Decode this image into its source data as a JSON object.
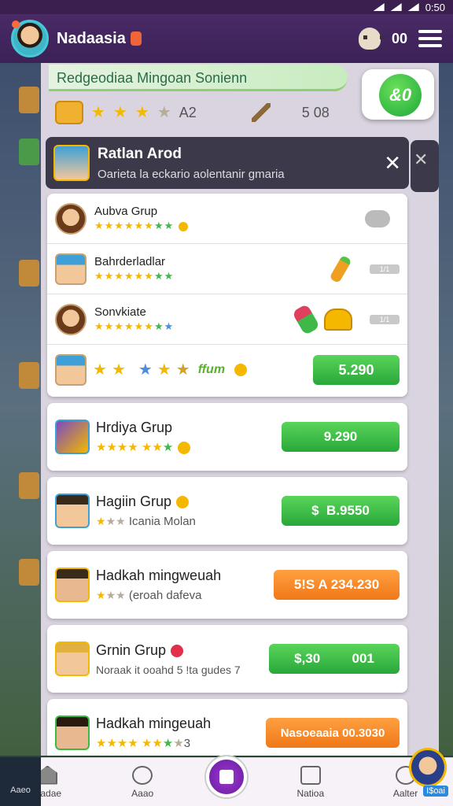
{
  "status_bar": {
    "time": "0:50"
  },
  "header": {
    "title": "Nadaasia",
    "coins": "00"
  },
  "panel": {
    "top_strip": "Redgeodiaa Mingoan Sonienn",
    "green_button": "&0",
    "stats": {
      "rating": "A2",
      "count": "5 08"
    }
  },
  "notification": {
    "title": "Ratlan Arod",
    "subtitle": "Oarieta la eckario aolentanir gmaria",
    "bg_close": "✕"
  },
  "group_rows": [
    {
      "name": "Aubva Grup",
      "badge": ""
    },
    {
      "name": "Bahrderladlar",
      "badge": "1/1"
    },
    {
      "name": "Sonvkiate",
      "badge": "1/1"
    },
    {
      "name": "",
      "button": "5.290",
      "tag": "ffum"
    }
  ],
  "cards": [
    {
      "name": "Hrdiya Grup",
      "sub": "",
      "button": "9.290",
      "color": "green"
    },
    {
      "name": "Hagiin Grup",
      "sub": "Icania Molan",
      "button": "B.9550",
      "prefix": "$",
      "color": "green"
    },
    {
      "name": "Hadkah mingweuah",
      "sub": "(eroah dafeva",
      "button": "5!S A 234.230",
      "color": "orange"
    },
    {
      "name": "Grnin Grup",
      "sub": "Noraak it ooahd 5 !ta gudes 7",
      "button": "$,30",
      "button2": "001",
      "color": "green"
    },
    {
      "name": "Hadkah mingeuah",
      "sub": "3",
      "button": "Nasoeaaia 00.3030",
      "color": "orange"
    }
  ],
  "bottom_nav": {
    "items": [
      "Hadae",
      "Aaao",
      "",
      "Natioa",
      "Aalter"
    ],
    "avatar_label": "I$oai",
    "left_label": "Aaeo"
  },
  "colors": {
    "accent": "#3b2156",
    "green": "#28a83a",
    "orange": "#f07818"
  }
}
